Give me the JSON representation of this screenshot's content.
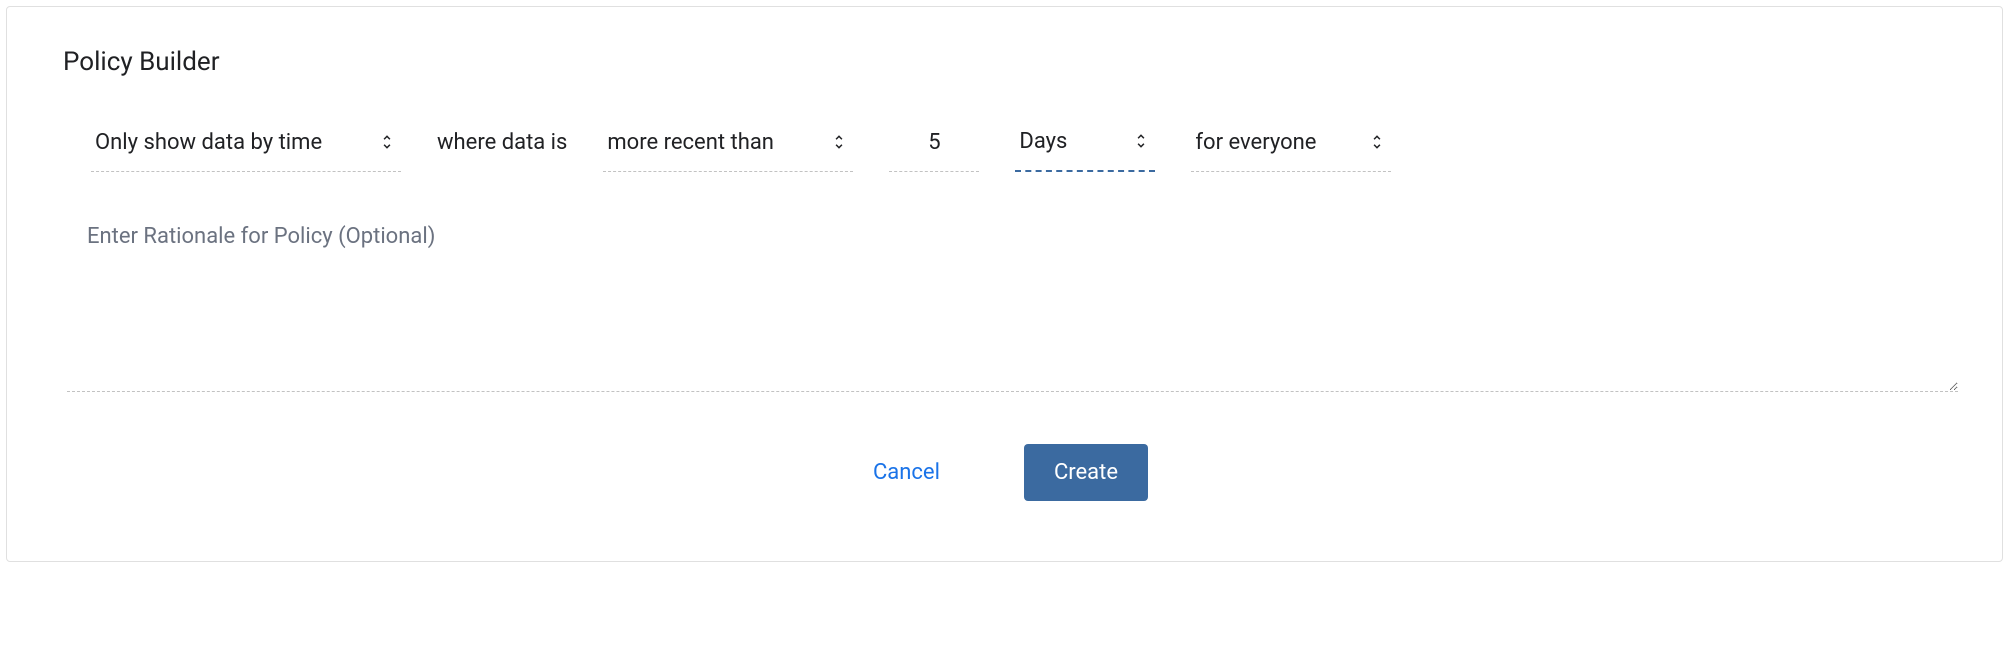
{
  "card": {
    "title": "Policy Builder"
  },
  "builder": {
    "filter_type": "Only show data by time",
    "where_label": "where data is",
    "comparator": "more recent than",
    "value": "5",
    "unit": "Days",
    "scope": "for everyone"
  },
  "rationale": {
    "placeholder": "Enter Rationale for Policy (Optional)",
    "value": ""
  },
  "actions": {
    "cancel": "Cancel",
    "create": "Create"
  }
}
